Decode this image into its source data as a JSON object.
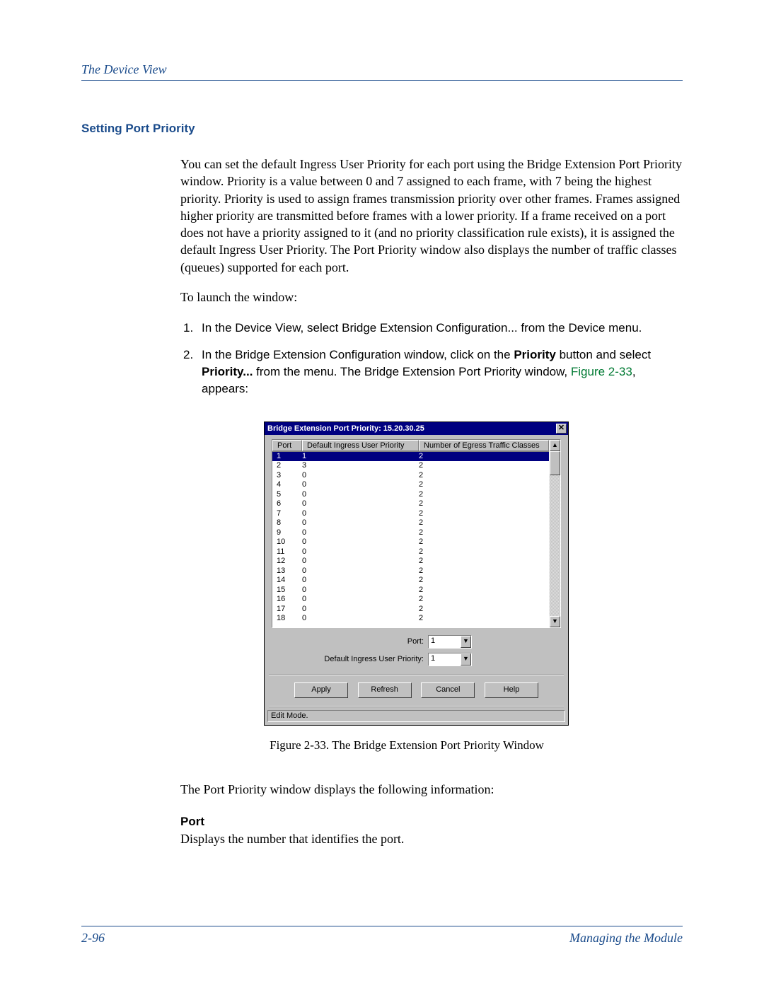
{
  "header": {
    "title": "The Device View"
  },
  "section": {
    "heading": "Setting Port Priority"
  },
  "intro": {
    "para": "You can set the default Ingress User Priority for each port using the Bridge Extension Port Priority window. Priority is a value between 0 and 7 assigned to each frame, with 7 being the highest priority. Priority is used to assign frames transmission priority over other frames. Frames assigned higher priority are transmitted before frames with a lower priority. If a frame received on a port does not have a priority assigned to it (and no priority classification rule exists), it is assigned the default Ingress User Priority. The Port Priority window also displays the number of traffic classes (queues) supported for each port.",
    "launch": "To launch the window:"
  },
  "steps": {
    "s1_num": "1.",
    "s1_text": "In the Device View, select Bridge Extension Configuration... from the Device menu.",
    "s2_num": "2.",
    "s2_a": "In the Bridge Extension Configuration window, click on the ",
    "s2_b": "Priority",
    "s2_c": " button and select ",
    "s2_d": "Priority...",
    "s2_e": " from the menu. The Bridge Extension Port Priority window, ",
    "s2_f": "Figure 2-33",
    "s2_g": ", appears:"
  },
  "win": {
    "title": "Bridge Extension Port Priority: 15.20.30.25",
    "close": "✕",
    "th_port": "Port",
    "th_dip": "Default Ingress User Priority",
    "th_nec": "Number of Egress Traffic Classes",
    "rows": [
      {
        "p": "1",
        "d": "1",
        "n": "2",
        "sel": true
      },
      {
        "p": "2",
        "d": "3",
        "n": "2"
      },
      {
        "p": "3",
        "d": "0",
        "n": "2"
      },
      {
        "p": "4",
        "d": "0",
        "n": "2"
      },
      {
        "p": "5",
        "d": "0",
        "n": "2"
      },
      {
        "p": "6",
        "d": "0",
        "n": "2"
      },
      {
        "p": "7",
        "d": "0",
        "n": "2"
      },
      {
        "p": "8",
        "d": "0",
        "n": "2"
      },
      {
        "p": "9",
        "d": "0",
        "n": "2"
      },
      {
        "p": "10",
        "d": "0",
        "n": "2"
      },
      {
        "p": "11",
        "d": "0",
        "n": "2"
      },
      {
        "p": "12",
        "d": "0",
        "n": "2"
      },
      {
        "p": "13",
        "d": "0",
        "n": "2"
      },
      {
        "p": "14",
        "d": "0",
        "n": "2"
      },
      {
        "p": "15",
        "d": "0",
        "n": "2"
      },
      {
        "p": "16",
        "d": "0",
        "n": "2"
      },
      {
        "p": "17",
        "d": "0",
        "n": "2"
      },
      {
        "p": "18",
        "d": "0",
        "n": "2"
      }
    ],
    "form": {
      "port_label": "Port:",
      "port_val": "1",
      "dip_label": "Default Ingress User Priority:",
      "dip_val": "1"
    },
    "buttons": {
      "apply": "Apply",
      "refresh": "Refresh",
      "cancel": "Cancel",
      "help": "Help"
    },
    "status": "Edit Mode.",
    "up": "▲",
    "down": "▼"
  },
  "figcap": "Figure 2-33.  The Bridge Extension Port Priority Window",
  "after": {
    "p1": "The Port Priority window displays the following information:",
    "h_port": "Port",
    "p_port": "Displays the number that identifies the port."
  },
  "footer": {
    "left": "2-96",
    "right": "Managing the Module"
  }
}
